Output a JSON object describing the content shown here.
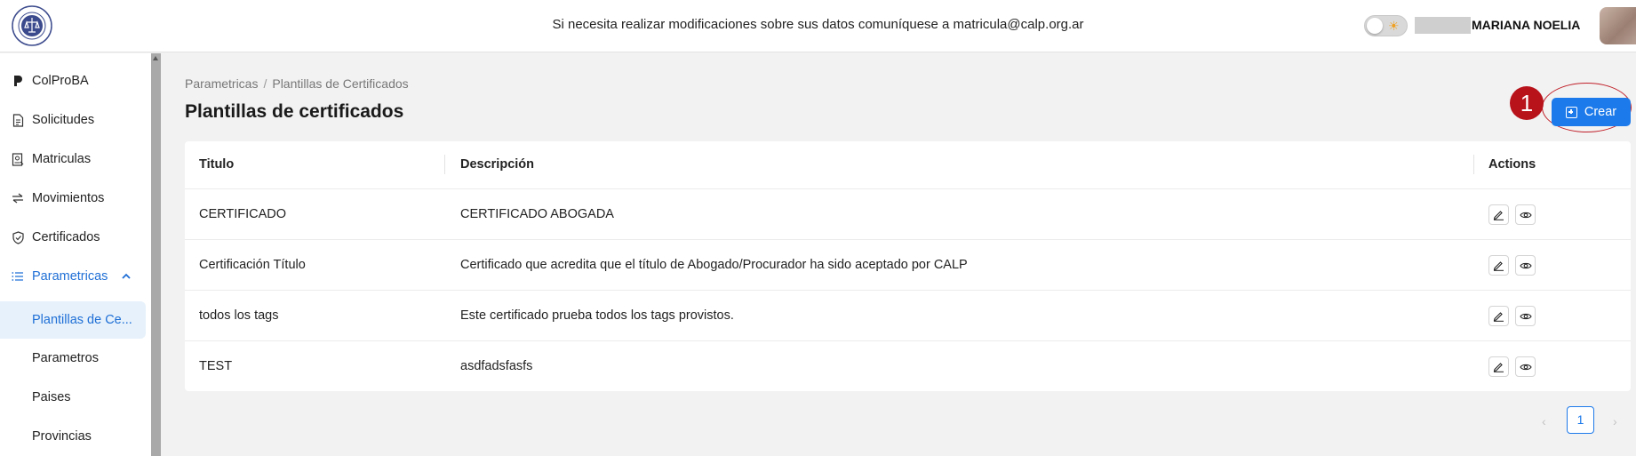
{
  "header": {
    "notice": "Si necesita realizar modificaciones sobre sus datos comuníquese a matricula@calp.org.ar",
    "user_name": "MARIANA NOELIA"
  },
  "sidebar": {
    "items": [
      {
        "label": "ColProBA",
        "icon": "colproba-logo-icon"
      },
      {
        "label": "Solicitudes",
        "icon": "document-icon"
      },
      {
        "label": "Matriculas",
        "icon": "id-card-icon"
      },
      {
        "label": "Movimientos",
        "icon": "swap-arrows-icon"
      },
      {
        "label": "Certificados",
        "icon": "shield-check-icon"
      },
      {
        "label": "Parametricas",
        "icon": "list-icon"
      }
    ],
    "subitems": [
      {
        "label": "Plantillas de Ce..."
      },
      {
        "label": "Parametros"
      },
      {
        "label": "Paises"
      },
      {
        "label": "Provincias"
      }
    ]
  },
  "breadcrumb": [
    "Parametricas",
    "/",
    "Plantillas de Certificados"
  ],
  "page_title": "Plantillas de certificados",
  "annotation_number": "1",
  "create_button_label": "Crear",
  "table": {
    "columns": [
      "Titulo",
      "Descripción",
      "Actions"
    ],
    "rows": [
      {
        "titulo": "CERTIFICADO",
        "descripcion": "CERTIFICADO ABOGADA"
      },
      {
        "titulo": "Certificación Título",
        "descripcion": "Certificado que acredita que el título de Abogado/Procurador ha sido aceptado por CALP"
      },
      {
        "titulo": "todos los tags",
        "descripcion": "Este certificado prueba todos los tags provistos."
      },
      {
        "titulo": "TEST",
        "descripcion": "asdfadsfasfs"
      }
    ]
  },
  "pagination": {
    "prev": "‹",
    "current_page": "1",
    "next": "›"
  },
  "colors": {
    "accent": "#1d7aea",
    "annotation": "#b8121b"
  }
}
